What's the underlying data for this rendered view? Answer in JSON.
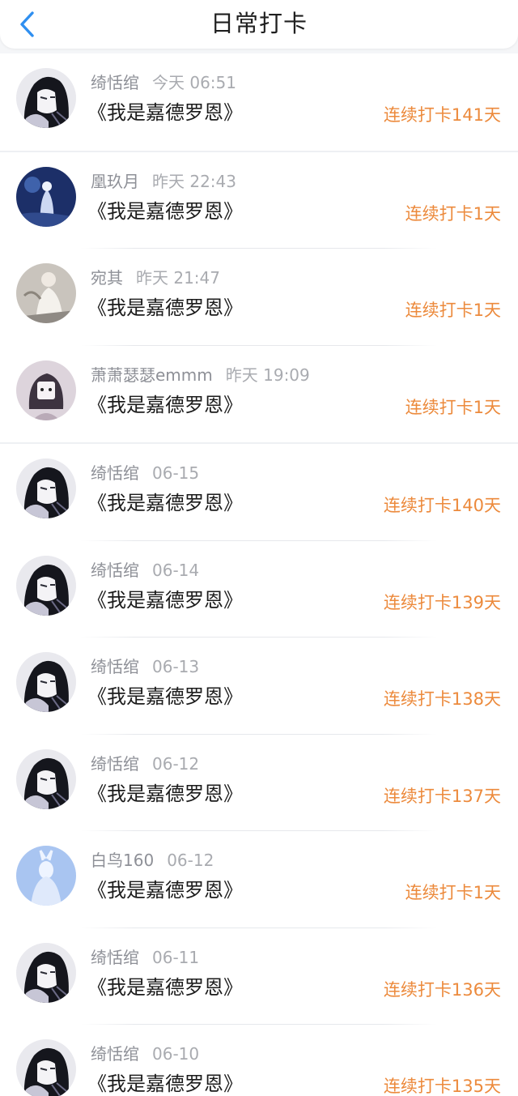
{
  "header": {
    "title": "日常打卡",
    "back_icon": "chevron-left-icon",
    "accent_color": "#2f8ff0"
  },
  "checkins": [
    {
      "user": "绮恬绾",
      "time": "今天 06:51",
      "book": "《我是嘉德罗恩》",
      "streak": "连续打卡141天",
      "avatar": "dark-hair-portrait"
    },
    {
      "user": "凰玖月",
      "time": "昨天 22:43",
      "book": "《我是嘉德罗恩》",
      "streak": "连续打卡1天",
      "avatar": "blue-night-figure"
    },
    {
      "user": "宛其",
      "time": "昨天 21:47",
      "book": "《我是嘉德罗恩》",
      "streak": "连续打卡1天",
      "avatar": "white-dress-figure"
    },
    {
      "user": "萧萧瑟瑟emmm",
      "time": "昨天 19:09",
      "book": "《我是嘉德罗恩》",
      "streak": "连续打卡1天",
      "avatar": "chibi-doll"
    },
    {
      "user": "绮恬绾",
      "time": "06-15",
      "book": "《我是嘉德罗恩》",
      "streak": "连续打卡140天",
      "avatar": "dark-hair-portrait"
    },
    {
      "user": "绮恬绾",
      "time": "06-14",
      "book": "《我是嘉德罗恩》",
      "streak": "连续打卡139天",
      "avatar": "dark-hair-portrait"
    },
    {
      "user": "绮恬绾",
      "time": "06-13",
      "book": "《我是嘉德罗恩》",
      "streak": "连续打卡138天",
      "avatar": "dark-hair-portrait"
    },
    {
      "user": "绮恬绾",
      "time": "06-12",
      "book": "《我是嘉德罗恩》",
      "streak": "连续打卡137天",
      "avatar": "dark-hair-portrait"
    },
    {
      "user": "白鸟160",
      "time": "06-12",
      "book": "《我是嘉德罗恩》",
      "streak": "连续打卡1天",
      "avatar": "light-blue-figure"
    },
    {
      "user": "绮恬绾",
      "time": "06-11",
      "book": "《我是嘉德罗恩》",
      "streak": "连续打卡136天",
      "avatar": "dark-hair-portrait"
    },
    {
      "user": "绮恬绾",
      "time": "06-10",
      "book": "《我是嘉德罗恩》",
      "streak": "连续打卡135天",
      "avatar": "dark-hair-portrait"
    }
  ],
  "colors": {
    "streak": "#ec8a3c",
    "meta": "#9a9ca2",
    "text": "#1b1b1b",
    "background": "#f5f6f8"
  }
}
